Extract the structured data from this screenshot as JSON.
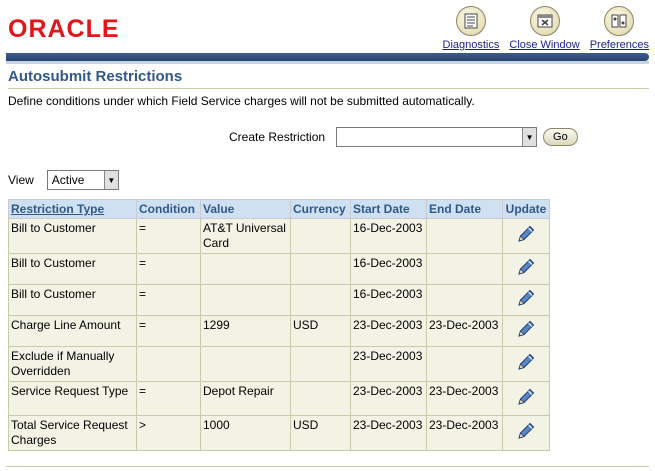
{
  "header": {
    "logo_text": "ORACLE",
    "buttons": [
      {
        "label": "Diagnostics",
        "icon": "diagnostics-icon"
      },
      {
        "label": "Close Window",
        "icon": "close-window-icon"
      },
      {
        "label": "Preferences",
        "icon": "preferences-icon"
      }
    ]
  },
  "page": {
    "title": "Autosubmit Restrictions",
    "instructions": "Define conditions under which Field Service charges will not be submitted automatically."
  },
  "create": {
    "label": "Create Restriction",
    "selected": "",
    "go_label": "Go"
  },
  "view": {
    "label": "View",
    "selected": "Active"
  },
  "table": {
    "columns": [
      "Restriction Type",
      "Condition",
      "Value",
      "Currency",
      "Start Date",
      "End Date",
      "Update"
    ],
    "rows": [
      {
        "type": "Bill to Customer",
        "condition": "=",
        "value": "AT&T Universal Card",
        "currency": "",
        "start": "16-Dec-2003",
        "end": ""
      },
      {
        "type": "Bill to Customer",
        "condition": "=",
        "value": "",
        "currency": "",
        "start": "16-Dec-2003",
        "end": ""
      },
      {
        "type": "Bill to Customer",
        "condition": "=",
        "value": "",
        "currency": "",
        "start": "16-Dec-2003",
        "end": ""
      },
      {
        "type": "Charge Line Amount",
        "condition": "=",
        "value": "1299",
        "currency": "USD",
        "start": "23-Dec-2003",
        "end": "23-Dec-2003"
      },
      {
        "type": "Exclude if Manually Overridden",
        "condition": "",
        "value": "",
        "currency": "",
        "start": "23-Dec-2003",
        "end": ""
      },
      {
        "type": "Service Request Type",
        "condition": "=",
        "value": "Depot Repair",
        "currency": "",
        "start": "23-Dec-2003",
        "end": "23-Dec-2003"
      },
      {
        "type": "Total Service Request Charges",
        "condition": ">",
        "value": "1000",
        "currency": "USD",
        "start": "23-Dec-2003",
        "end": "23-Dec-2003"
      }
    ]
  },
  "colors": {
    "brand_red": "#e0161b",
    "title_blue": "#30598a",
    "header_cell": "#cfe0f1",
    "row_cell": "#f2f2e5",
    "link": "#1a1f8f"
  }
}
